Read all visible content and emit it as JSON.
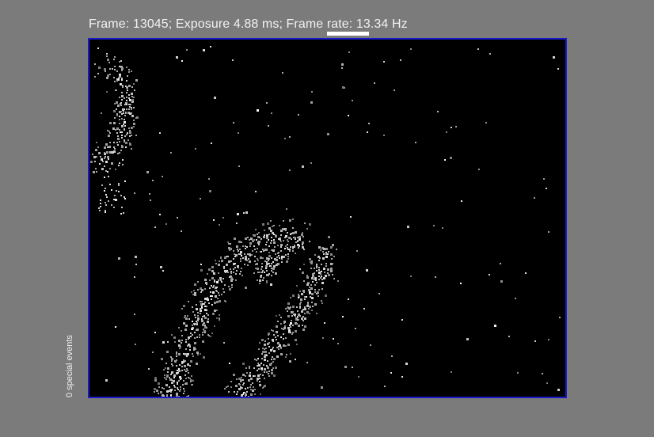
{
  "header": {
    "status_text": "Frame: 13045; Exposure 4.88 ms; Frame rate: 13.34 Hz"
  },
  "side_panel": {
    "events_text": "0 special events"
  },
  "colors": {
    "background": "#7b7b7b",
    "viewer_background": "#000000",
    "viewer_border": "#1a1ac8",
    "text": "#f2f2f2",
    "indicator": "#ffffff"
  }
}
